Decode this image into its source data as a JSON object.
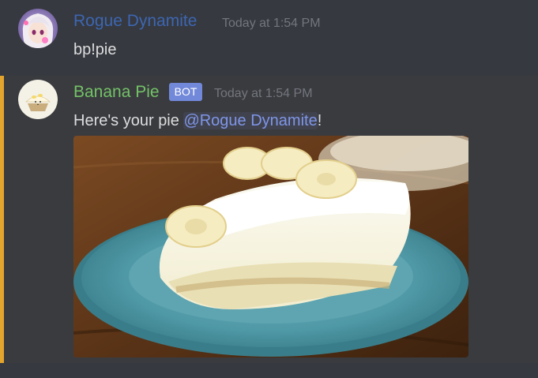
{
  "messages": [
    {
      "author": "Rogue Dynamite",
      "author_color": "#3d66b2",
      "timestamp": "Today at 1:54 PM",
      "text": "bp!pie"
    },
    {
      "author": "Banana Pie",
      "author_color": "#73c267",
      "badge": "BOT",
      "timestamp": "Today at 1:54 PM",
      "text_before": "Here's your pie ",
      "mention": "@Rogue Dynamite",
      "text_after": "!",
      "avatar_caption": "BANANA PIE",
      "image_icon": "banana-cream-pie-photo"
    }
  ],
  "colors": {
    "background": "#36393f",
    "mention_highlight": "#e3a52e",
    "mention_text": "#7f95e8",
    "bot_badge": "#7289da",
    "timestamp": "#72767d",
    "message_text": "#dcddde"
  }
}
